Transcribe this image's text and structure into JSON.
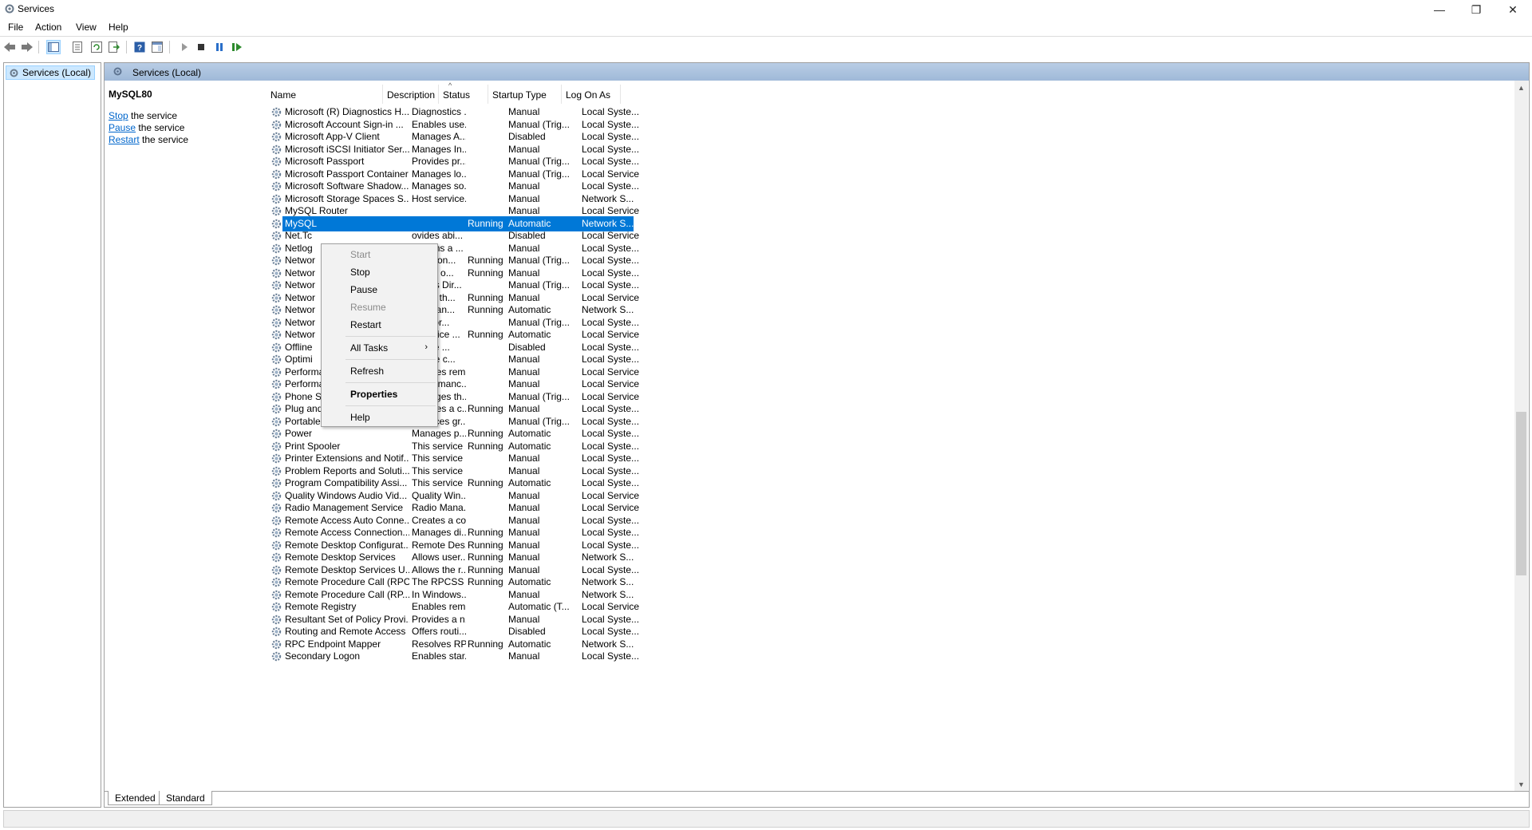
{
  "window": {
    "title": "Services",
    "minimize": "—",
    "maximize": "❐",
    "close": "✕"
  },
  "menu": [
    "File",
    "Action",
    "View",
    "Help"
  ],
  "tree": {
    "root": "Services (Local)"
  },
  "main": {
    "header": "Services (Local)",
    "detail": {
      "service_name": "MySQL80",
      "actions": [
        {
          "link": "Stop",
          "rest": " the service"
        },
        {
          "link": "Pause",
          "rest": " the service"
        },
        {
          "link": "Restart",
          "rest": " the service"
        }
      ]
    },
    "columns": {
      "name": "Name",
      "description": "Description",
      "status": "Status",
      "startup": "Startup Type",
      "logon": "Log On As"
    },
    "sort_indicator": "^",
    "rows": [
      {
        "name": "Microsoft (R) Diagnostics H...",
        "desc": "Diagnostics ...",
        "status": "",
        "start": "Manual",
        "logon": "Local Syste..."
      },
      {
        "name": "Microsoft Account Sign-in ...",
        "desc": "Enables use...",
        "status": "",
        "start": "Manual (Trig...",
        "logon": "Local Syste..."
      },
      {
        "name": "Microsoft App-V Client",
        "desc": "Manages A...",
        "status": "",
        "start": "Disabled",
        "logon": "Local Syste..."
      },
      {
        "name": "Microsoft iSCSI Initiator Ser...",
        "desc": "Manages In...",
        "status": "",
        "start": "Manual",
        "logon": "Local Syste..."
      },
      {
        "name": "Microsoft Passport",
        "desc": "Provides pr...",
        "status": "",
        "start": "Manual (Trig...",
        "logon": "Local Syste..."
      },
      {
        "name": "Microsoft Passport Container",
        "desc": "Manages lo...",
        "status": "",
        "start": "Manual (Trig...",
        "logon": "Local Service"
      },
      {
        "name": "Microsoft Software Shadow...",
        "desc": "Manages so...",
        "status": "",
        "start": "Manual",
        "logon": "Local Syste..."
      },
      {
        "name": "Microsoft Storage Spaces S...",
        "desc": "Host service...",
        "status": "",
        "start": "Manual",
        "logon": "Network S..."
      },
      {
        "name": "MySQL Router",
        "desc": "",
        "status": "",
        "start": "Manual",
        "logon": "Local Service"
      },
      {
        "name": "MySQL",
        "desc": "",
        "status": "Running",
        "start": "Automatic",
        "logon": "Network S...",
        "selected": true
      },
      {
        "name": "Net.Tc",
        "desc": "ovides abi...",
        "status": "",
        "start": "Disabled",
        "logon": "Local Service"
      },
      {
        "name": "Netlog",
        "desc": "aintains a ...",
        "status": "",
        "start": "Manual",
        "logon": "Local Syste..."
      },
      {
        "name": "Networ",
        "desc": "kers con...",
        "status": "Running",
        "start": "Manual (Trig...",
        "logon": "Local Syste..."
      },
      {
        "name": "Networ",
        "desc": "nages o...",
        "status": "Running",
        "start": "Manual",
        "logon": "Local Syste..."
      },
      {
        "name": "Networ",
        "desc": "ovides Dir...",
        "status": "",
        "start": "Manual (Trig...",
        "logon": "Local Syste..."
      },
      {
        "name": "Networ",
        "desc": "ntifies th...",
        "status": "Running",
        "start": "Manual",
        "logon": "Local Service"
      },
      {
        "name": "Networ",
        "desc": "llects an...",
        "status": "Running",
        "start": "Automatic",
        "logon": "Network S..."
      },
      {
        "name": "Networ",
        "desc": "Networ...",
        "status": "",
        "start": "Manual (Trig...",
        "logon": "Local Syste..."
      },
      {
        "name": "Networ",
        "desc": "s service ...",
        "status": "Running",
        "start": "Automatic",
        "logon": "Local Service"
      },
      {
        "name": "Offline",
        "desc": "Offline ...",
        "status": "",
        "start": "Disabled",
        "logon": "Local Syste..."
      },
      {
        "name": "Optimi",
        "desc": "lps the c...",
        "status": "",
        "start": "Manual",
        "logon": "Local Syste..."
      },
      {
        "name": "Performance Counter DLL ...",
        "desc": "Enables rem...",
        "status": "",
        "start": "Manual",
        "logon": "Local Service"
      },
      {
        "name": "Performance Logs & Alerts",
        "desc": "Performanc...",
        "status": "",
        "start": "Manual",
        "logon": "Local Service"
      },
      {
        "name": "Phone Service",
        "desc": "Manages th...",
        "status": "",
        "start": "Manual (Trig...",
        "logon": "Local Service"
      },
      {
        "name": "Plug and Play",
        "desc": "Enables a c...",
        "status": "Running",
        "start": "Manual",
        "logon": "Local Syste..."
      },
      {
        "name": "Portable Device Enumerator...",
        "desc": "Enforces gr...",
        "status": "",
        "start": "Manual (Trig...",
        "logon": "Local Syste..."
      },
      {
        "name": "Power",
        "desc": "Manages p...",
        "status": "Running",
        "start": "Automatic",
        "logon": "Local Syste..."
      },
      {
        "name": "Print Spooler",
        "desc": "This service ...",
        "status": "Running",
        "start": "Automatic",
        "logon": "Local Syste..."
      },
      {
        "name": "Printer Extensions and Notif...",
        "desc": "This service ...",
        "status": "",
        "start": "Manual",
        "logon": "Local Syste..."
      },
      {
        "name": "Problem Reports and Soluti...",
        "desc": "This service ...",
        "status": "",
        "start": "Manual",
        "logon": "Local Syste..."
      },
      {
        "name": "Program Compatibility Assi...",
        "desc": "This service ...",
        "status": "Running",
        "start": "Automatic",
        "logon": "Local Syste..."
      },
      {
        "name": "Quality Windows Audio Vid...",
        "desc": "Quality Win...",
        "status": "",
        "start": "Manual",
        "logon": "Local Service"
      },
      {
        "name": "Radio Management Service",
        "desc": "Radio Mana...",
        "status": "",
        "start": "Manual",
        "logon": "Local Service"
      },
      {
        "name": "Remote Access Auto Conne...",
        "desc": "Creates a co...",
        "status": "",
        "start": "Manual",
        "logon": "Local Syste..."
      },
      {
        "name": "Remote Access Connection...",
        "desc": "Manages di...",
        "status": "Running",
        "start": "Manual",
        "logon": "Local Syste..."
      },
      {
        "name": "Remote Desktop Configurat...",
        "desc": "Remote Des...",
        "status": "Running",
        "start": "Manual",
        "logon": "Local Syste..."
      },
      {
        "name": "Remote Desktop Services",
        "desc": "Allows user...",
        "status": "Running",
        "start": "Manual",
        "logon": "Network S..."
      },
      {
        "name": "Remote Desktop Services U...",
        "desc": "Allows the r...",
        "status": "Running",
        "start": "Manual",
        "logon": "Local Syste..."
      },
      {
        "name": "Remote Procedure Call (RPC)",
        "desc": "The RPCSS ...",
        "status": "Running",
        "start": "Automatic",
        "logon": "Network S..."
      },
      {
        "name": "Remote Procedure Call (RP...",
        "desc": "In Windows...",
        "status": "",
        "start": "Manual",
        "logon": "Network S..."
      },
      {
        "name": "Remote Registry",
        "desc": "Enables rem...",
        "status": "",
        "start": "Automatic (T...",
        "logon": "Local Service"
      },
      {
        "name": "Resultant Set of Policy Provi...",
        "desc": "Provides a n...",
        "status": "",
        "start": "Manual",
        "logon": "Local Syste..."
      },
      {
        "name": "Routing and Remote Access",
        "desc": "Offers routi...",
        "status": "",
        "start": "Disabled",
        "logon": "Local Syste..."
      },
      {
        "name": "RPC Endpoint Mapper",
        "desc": "Resolves RP...",
        "status": "Running",
        "start": "Automatic",
        "logon": "Network S..."
      },
      {
        "name": "Secondary Logon",
        "desc": "Enables star...",
        "status": "",
        "start": "Manual",
        "logon": "Local Syste..."
      }
    ]
  },
  "context_menu": {
    "start": "Start",
    "stop": "Stop",
    "pause": "Pause",
    "resume": "Resume",
    "restart": "Restart",
    "all_tasks": "All Tasks",
    "all_tasks_arrow": "›",
    "refresh": "Refresh",
    "properties": "Properties",
    "help": "Help"
  },
  "tabs": {
    "extended": "Extended",
    "standard": "Standard"
  },
  "scrollbar": {
    "up": "▲",
    "down": "▼"
  },
  "colors": {
    "selection": "#0078d7",
    "header_band": "#9fb9d8",
    "link": "#0066cc"
  }
}
